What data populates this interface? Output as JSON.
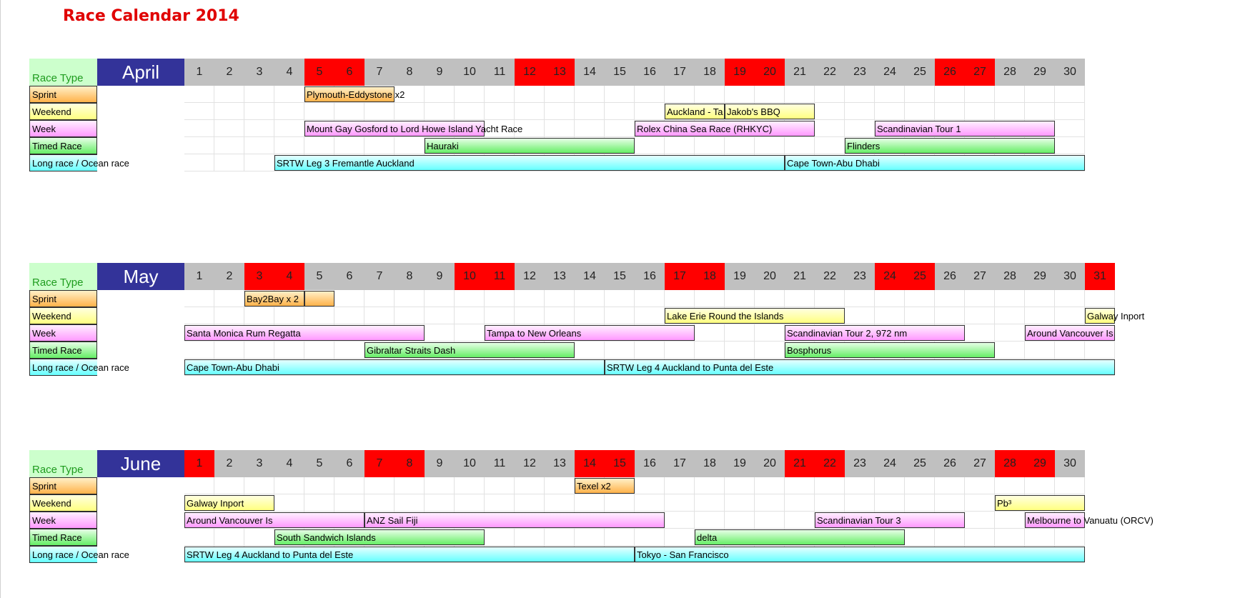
{
  "title": "Race Calendar 2014",
  "race_type_header": "Race Type",
  "race_types": [
    {
      "key": "sprint",
      "label": "Sprint",
      "color": "#ffb24a"
    },
    {
      "key": "weekend",
      "label": "Weekend",
      "color": "#ffff80"
    },
    {
      "key": "week",
      "label": "Week",
      "color": "#ff99ff"
    },
    {
      "key": "timed",
      "label": "Timed Race",
      "color": "#66ee66"
    },
    {
      "key": "long",
      "label": "Long race / Ocean race",
      "color": "#66ffff"
    }
  ],
  "colors": {
    "title": "#e00000",
    "month_bg": "#333399",
    "day_bg": "#c0c0c0",
    "weekend_day_bg": "#ff0000",
    "race_type_header_bg": "#ccffcc",
    "race_type_header_text": "#1f9c1f"
  },
  "months": [
    {
      "name": "April",
      "days": 30,
      "weekend_days": [
        5,
        6,
        12,
        13,
        19,
        20,
        26,
        27
      ],
      "races": [
        {
          "type": "sprint",
          "label": "Plymouth-Eddystone x2",
          "start": 5,
          "end": 7
        },
        {
          "type": "weekend",
          "label": "Auckland - Ta",
          "start": 17,
          "end": 18
        },
        {
          "type": "weekend",
          "label": "Jakob's BBQ",
          "start": 19,
          "end": 21
        },
        {
          "type": "week",
          "label": "Mount Gay Gosford to Lord Howe Island Yacht Race",
          "start": 5,
          "end": 10
        },
        {
          "type": "week",
          "label": "Rolex China Sea Race (RHKYC)",
          "start": 16,
          "end": 21
        },
        {
          "type": "week",
          "label": "Scandinavian Tour 1",
          "start": 24,
          "end": 29
        },
        {
          "type": "timed",
          "label": "Hauraki",
          "start": 9,
          "end": 15
        },
        {
          "type": "timed",
          "label": "Flinders",
          "start": 23,
          "end": 29
        },
        {
          "type": "long",
          "label": "SRTW Leg 3 Fremantle Auckland",
          "start": 4,
          "end": 20
        },
        {
          "type": "long",
          "label": "Cape Town-Abu Dhabi",
          "start": 21,
          "end": 30
        }
      ]
    },
    {
      "name": "May",
      "days": 31,
      "weekend_days": [
        3,
        4,
        10,
        11,
        17,
        18,
        24,
        25,
        31
      ],
      "races": [
        {
          "type": "sprint",
          "label": "Bay2Bay x 2",
          "start": 3,
          "end": 4
        },
        {
          "type": "sprint",
          "label": "",
          "start": 5,
          "end": 5
        },
        {
          "type": "weekend",
          "label": "Lake Erie Round the Islands",
          "start": 17,
          "end": 22
        },
        {
          "type": "weekend",
          "label": "Galway Inport",
          "start": 31,
          "end": 31
        },
        {
          "type": "week",
          "label": "Santa Monica Rum Regatta",
          "start": 1,
          "end": 8
        },
        {
          "type": "week",
          "label": "Tampa to New Orleans",
          "start": 11,
          "end": 17
        },
        {
          "type": "week",
          "label": "Scandinavian Tour 2, 972 nm",
          "start": 21,
          "end": 26
        },
        {
          "type": "week",
          "label": "Around Vancouver Is",
          "start": 29,
          "end": 31
        },
        {
          "type": "timed",
          "label": "Gibraltar Straits Dash",
          "start": 7,
          "end": 13
        },
        {
          "type": "timed",
          "label": "Bosphorus",
          "start": 21,
          "end": 27
        },
        {
          "type": "long",
          "label": "Cape Town-Abu Dhabi",
          "start": 1,
          "end": 14
        },
        {
          "type": "long",
          "label": "SRTW Leg 4 Auckland to Punta del Este",
          "start": 15,
          "end": 31
        }
      ]
    },
    {
      "name": "June",
      "days": 30,
      "weekend_days": [
        1,
        7,
        8,
        14,
        15,
        21,
        22,
        28,
        29
      ],
      "races": [
        {
          "type": "sprint",
          "label": "Texel x2",
          "start": 14,
          "end": 15
        },
        {
          "type": "weekend",
          "label": "Galway Inport",
          "start": 1,
          "end": 3
        },
        {
          "type": "weekend",
          "label": "Pb³",
          "start": 28,
          "end": 30
        },
        {
          "type": "week",
          "label": "Around Vancouver Is",
          "start": 1,
          "end": 6
        },
        {
          "type": "week",
          "label": "ANZ Sail Fiji",
          "start": 7,
          "end": 16
        },
        {
          "type": "week",
          "label": "Scandinavian Tour 3",
          "start": 22,
          "end": 26
        },
        {
          "type": "week",
          "label": "Melbourne to Vanuatu (ORCV)",
          "start": 29,
          "end": 30
        },
        {
          "type": "timed",
          "label": "South Sandwich Islands",
          "start": 4,
          "end": 10
        },
        {
          "type": "timed",
          "label": "delta",
          "start": 18,
          "end": 24
        },
        {
          "type": "long",
          "label": "SRTW Leg 4 Auckland to Punta del Este",
          "start": 1,
          "end": 15
        },
        {
          "type": "long",
          "label": "Tokyo - San Francisco",
          "start": 16,
          "end": 30
        }
      ]
    }
  ]
}
